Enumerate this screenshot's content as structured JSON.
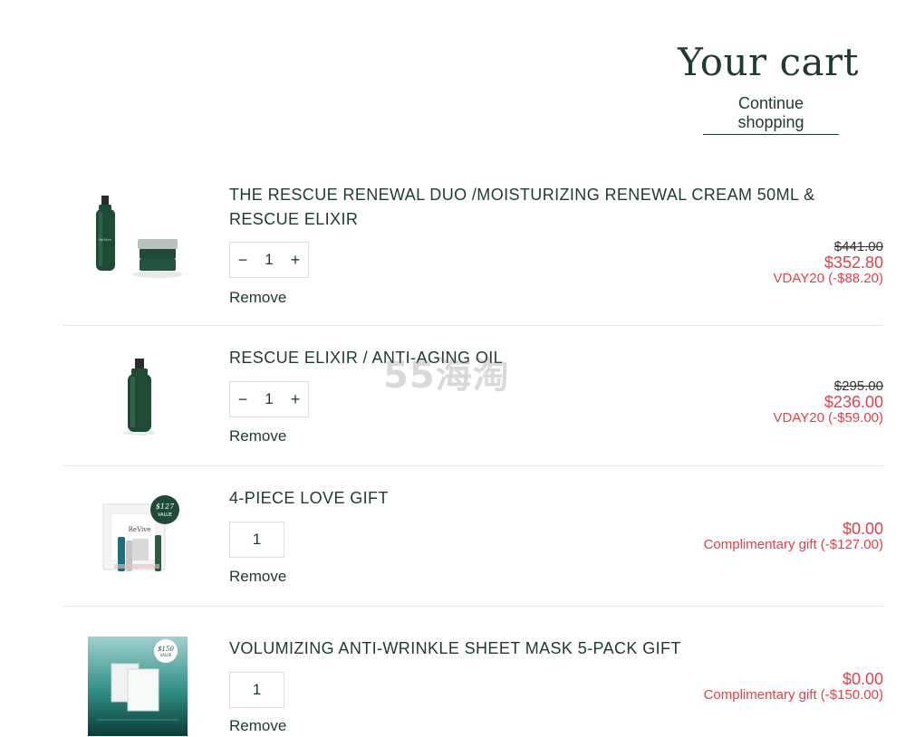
{
  "header": {
    "title": "Your cart",
    "continue_label": "Continue shopping"
  },
  "items": [
    {
      "name": "THE RESCUE RENEWAL DUO /MOISTURIZING RENEWAL CREAM 50ML & RESCUE ELIXIR",
      "quantity": "1",
      "original_price": "$441.00",
      "price": "$352.80",
      "discount": "VDAY20 (-$88.20)",
      "remove_label": "Remove",
      "minus_symbol": "−",
      "plus_symbol": "+"
    },
    {
      "name": "RESCUE ELIXIR / ANTI-AGING OIL",
      "quantity": "1",
      "original_price": "$295.00",
      "price": "$236.00",
      "discount": "VDAY20 (-$59.00)",
      "remove_label": "Remove",
      "minus_symbol": "−",
      "plus_symbol": "+"
    },
    {
      "name": "4-PIECE LOVE GIFT",
      "quantity": "1",
      "price": "$0.00",
      "discount": "Complimentary gift (-$127.00)",
      "remove_label": "Remove",
      "badge_price": "$127",
      "badge_text": "VALUE",
      "pack_brand": "ReVive"
    },
    {
      "name": "VOLUMIZING ANTI-WRINKLE SHEET MASK 5-PACK GIFT",
      "quantity": "1",
      "price": "$0.00",
      "discount": "Complimentary gift (-$150.00)",
      "remove_label": "Remove",
      "badge_price": "$150",
      "badge_text": "VALUE"
    }
  ],
  "watermark": "55海淘",
  "colors": {
    "text": "#1f3a2e",
    "sale": "#e0434a",
    "bottle": "#1e4a36",
    "divider": "#e4e4e4"
  }
}
